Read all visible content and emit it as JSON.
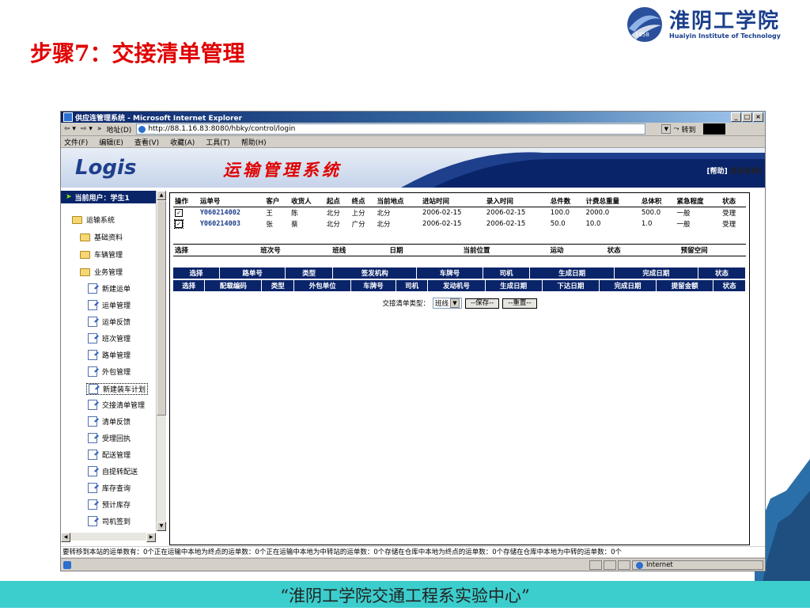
{
  "slide": {
    "title": "步骤7：交接清单管理",
    "footer": "“淮阴工学院交通工程系实验中心”",
    "logo_cn": "淮阴工学院",
    "logo_en": "Huaiyin Institute of Technology",
    "logo_year": "1958"
  },
  "browser": {
    "title": "供应连管理系统 - Microsoft Internet Explorer",
    "address_label": "地址(D)",
    "url": "http://88.1.16.83:8080/hbky/control/login",
    "go_label": "转到",
    "menu": [
      "文件(F)",
      "编辑(E)",
      "查看(V)",
      "收藏(A)",
      "工具(T)",
      "帮助(H)"
    ],
    "status_zone": "Internet"
  },
  "app": {
    "logo": "Logis",
    "system_title": "运输管理系统",
    "help_link": "[帮助]",
    "logout_link": "退出系统]",
    "current_user": "当前用户：学生1",
    "tree": {
      "root": "运输系统",
      "folders": [
        "基础资料",
        "车辆管理",
        "业务管理"
      ],
      "items": [
        "新建运单",
        "运单管理",
        "运单反馈",
        "班次管理",
        "路单管理",
        "外包管理",
        "新建装车计划",
        "交接清单管理",
        "清单反馈",
        "受理回执",
        "配送管理",
        "自提转配送",
        "库存查询",
        "预计库存",
        "司机签到"
      ]
    },
    "waybill_table": {
      "headers": [
        "操作",
        "运单号",
        "客户",
        "收货人",
        "起点",
        "终点",
        "当前地点",
        "进站时间",
        "录入时间",
        "总件数",
        "计费总重量",
        "总体积",
        "紧急程度",
        "状态"
      ],
      "rows": [
        {
          "check": "✓",
          "code": "Y060214002",
          "customer": "王",
          "receiver": "陈",
          "from": "北分",
          "to": "上分",
          "current": "北分",
          "in_time": "2006-02-15",
          "entry_time": "2006-02-15",
          "pieces": "100.0",
          "weight": "2000.0",
          "volume": "500.0",
          "urgency": "一般",
          "status": "受理"
        },
        {
          "check": "✓",
          "code": "Y060214003",
          "customer": "张",
          "receiver": "蔡",
          "from": "北分",
          "to": "广分",
          "current": "北分",
          "in_time": "2006-02-15",
          "entry_time": "2006-02-15",
          "pieces": "50.0",
          "weight": "10.0",
          "volume": "1.0",
          "urgency": "一般",
          "status": "受理"
        }
      ]
    },
    "shift_table_headers": [
      "选择",
      "班次号",
      "班线",
      "日期",
      "当前位置",
      "运动",
      "状态",
      "预留空间"
    ],
    "route_headers": [
      "选择",
      "路单号",
      "类型",
      "签发机构",
      "车牌号",
      "司机",
      "生成日期",
      "完成日期",
      "状态"
    ],
    "stowage_headers": [
      "选择",
      "配载编码",
      "类型",
      "外包单位",
      "车牌号",
      "司机",
      "发动机号",
      "生成日期",
      "下达日期",
      "完成日期",
      "提留金额",
      "状态"
    ],
    "form": {
      "type_label": "交接清单类型：",
      "type_value": "班线",
      "save_button": "--保存--",
      "reset_button": "--重置--"
    },
    "status_line": "要转移到本站的运单数有：0个正在运输中本地为终点的运单数：0个正在运输中本地为中转站的运单数：0个存储在仓库中本地为终点的运单数：0个存储在仓库中本地为中转的运单数：0个"
  }
}
